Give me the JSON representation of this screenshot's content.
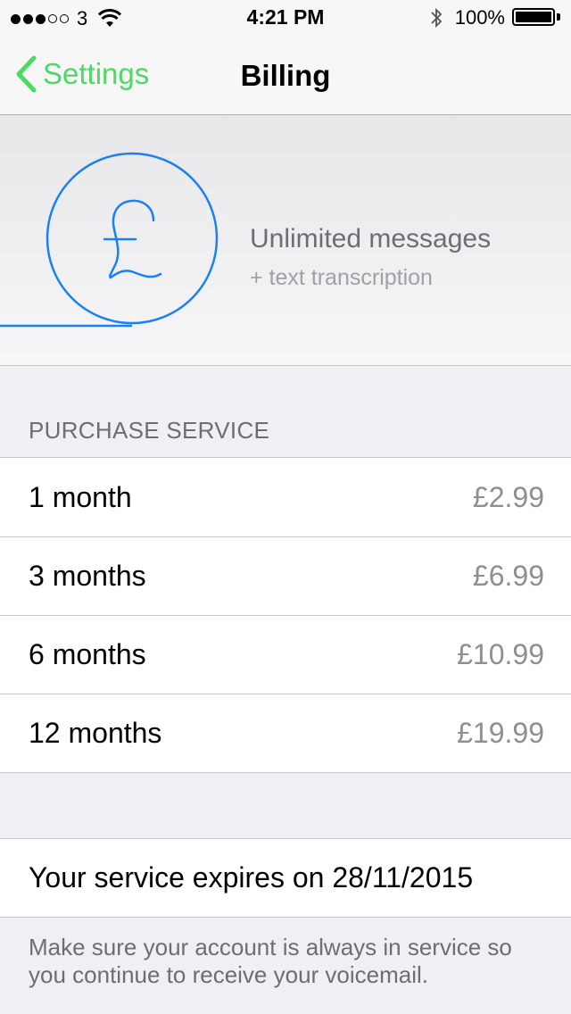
{
  "status_bar": {
    "carrier": "3",
    "time": "4:21 PM",
    "battery": "100%"
  },
  "nav": {
    "back_label": "Settings",
    "title": "Billing"
  },
  "hero": {
    "icon": "pound-sign-icon",
    "title": "Unlimited messages",
    "subtitle": "+ text transcription"
  },
  "purchase": {
    "header": "PURCHASE SERVICE",
    "options": [
      {
        "label": "1 month",
        "price": "£2.99"
      },
      {
        "label": "3 months",
        "price": "£6.99"
      },
      {
        "label": "6 months",
        "price": "£10.99"
      },
      {
        "label": "12 months",
        "price": "£19.99"
      }
    ]
  },
  "expiry": {
    "text": "Your service expires on 28/11/2015"
  },
  "footer": {
    "note": "Make sure your account is always in service so you continue to receive your voicemail."
  },
  "colors": {
    "accent_green": "#4cd964",
    "accent_blue": "#1a82f0",
    "secondary_text": "#8e8e93"
  }
}
